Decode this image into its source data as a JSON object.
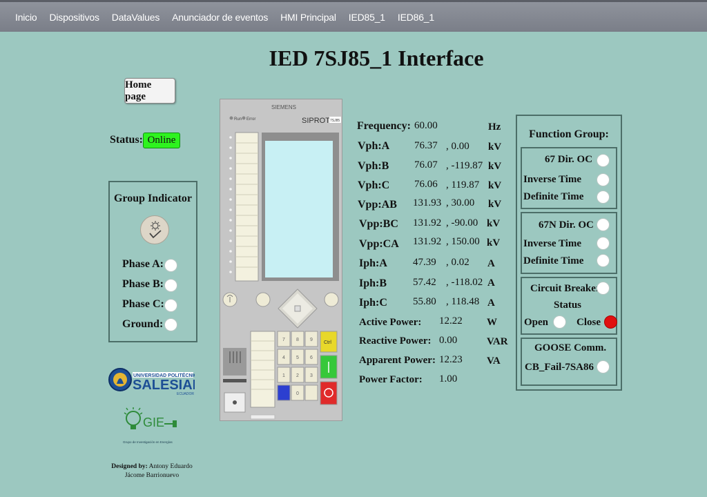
{
  "nav": {
    "items": [
      "Inicio",
      "Dispositivos",
      "DataValues",
      "Anunciador de eventos",
      "HMI Principal",
      "IED85_1",
      "IED86_1"
    ]
  },
  "page": {
    "title": "IED 7SJ85_1 Interface",
    "home_button": "Home page",
    "status_label": "Status:",
    "status_value": "Online"
  },
  "group_indicator": {
    "title": "Group Indicator",
    "icon": "settings-check-icon",
    "rows": [
      "Phase A:",
      "Phase B:",
      "Phase C:",
      "Ground:"
    ]
  },
  "logos": {
    "ups_top": "UNIVERSIDAD POLITÉCNICA",
    "ups_main": "SALESIANA",
    "ups_sub": "ECUADOR",
    "gie_main": "GIE",
    "gie_sub": "Grupo de Investigación en Energías"
  },
  "credits": {
    "label": "Designed by:",
    "line1": "Antony Eduardo",
    "line2": "Jácome Barrionuevo"
  },
  "device": {
    "brand": "SIEMENS",
    "model": "SIPROTEC",
    "model_tag": "7SJ85",
    "run_label": "Run",
    "error_label": "Error",
    "ctrl_label": "Ctrl",
    "keys": [
      "7",
      "8",
      "9",
      "4",
      "5",
      "6",
      "1",
      "2",
      "3",
      "0"
    ]
  },
  "readings": {
    "voltages": [
      {
        "label": "Frequency:",
        "mag": "60.00",
        "ang": "",
        "unit": "Hz"
      },
      {
        "label": "Vph:A",
        "mag": "76.37",
        "ang": ", 0.00",
        "unit": "kV"
      },
      {
        "label": "Vph:B",
        "mag": "76.07",
        "ang": ", -119.87",
        "unit": "kV"
      },
      {
        "label": "Vph:C",
        "mag": "76.06",
        "ang": ", 119.87",
        "unit": "kV"
      },
      {
        "label": "Vpp:AB",
        "mag": "131.93",
        "ang": ", 30.00",
        "unit": "kV"
      },
      {
        "label": "Vpp:BC",
        "mag": "131.92",
        "ang": ", -90.00",
        "unit": "kV"
      },
      {
        "label": "Vpp:CA",
        "mag": "131.92",
        "ang": ", 150.00",
        "unit": "kV"
      },
      {
        "label": "Iph:A",
        "mag": "47.39",
        "ang": ", 0.02",
        "unit": "A"
      },
      {
        "label": "Iph:B",
        "mag": "57.42",
        "ang": ", -118.02",
        "unit": "A"
      },
      {
        "label": "Iph:C",
        "mag": "55.80",
        "ang": ", 118.48",
        "unit": "A"
      }
    ],
    "power": [
      {
        "label": "Active Power:",
        "value": "12.22",
        "unit": "W"
      },
      {
        "label": "Reactive Power:",
        "value": "0.00",
        "unit": "VAR"
      },
      {
        "label": "Apparent Power:",
        "value": "12.23",
        "unit": "VA"
      },
      {
        "label": "Power Factor:",
        "value": "1.00",
        "unit": ""
      }
    ]
  },
  "function_group": {
    "title": "Function Group:",
    "dir_oc": {
      "title": "67 Dir. OC",
      "inverse": "Inverse Time",
      "definite": "Definite Time"
    },
    "dir_oc_n": {
      "title": "67N Dir. OC",
      "inverse": "Inverse Time",
      "definite": "Definite Time"
    },
    "breaker": {
      "title": "Circuit Breaker",
      "title2": "Status",
      "open": "Open",
      "close": "Close"
    },
    "goose": {
      "title": "GOOSE Comm.",
      "item": "CB_Fail-7SA86"
    },
    "colors": {
      "led_off": "#ffffff",
      "led_on": "#e01010"
    }
  }
}
